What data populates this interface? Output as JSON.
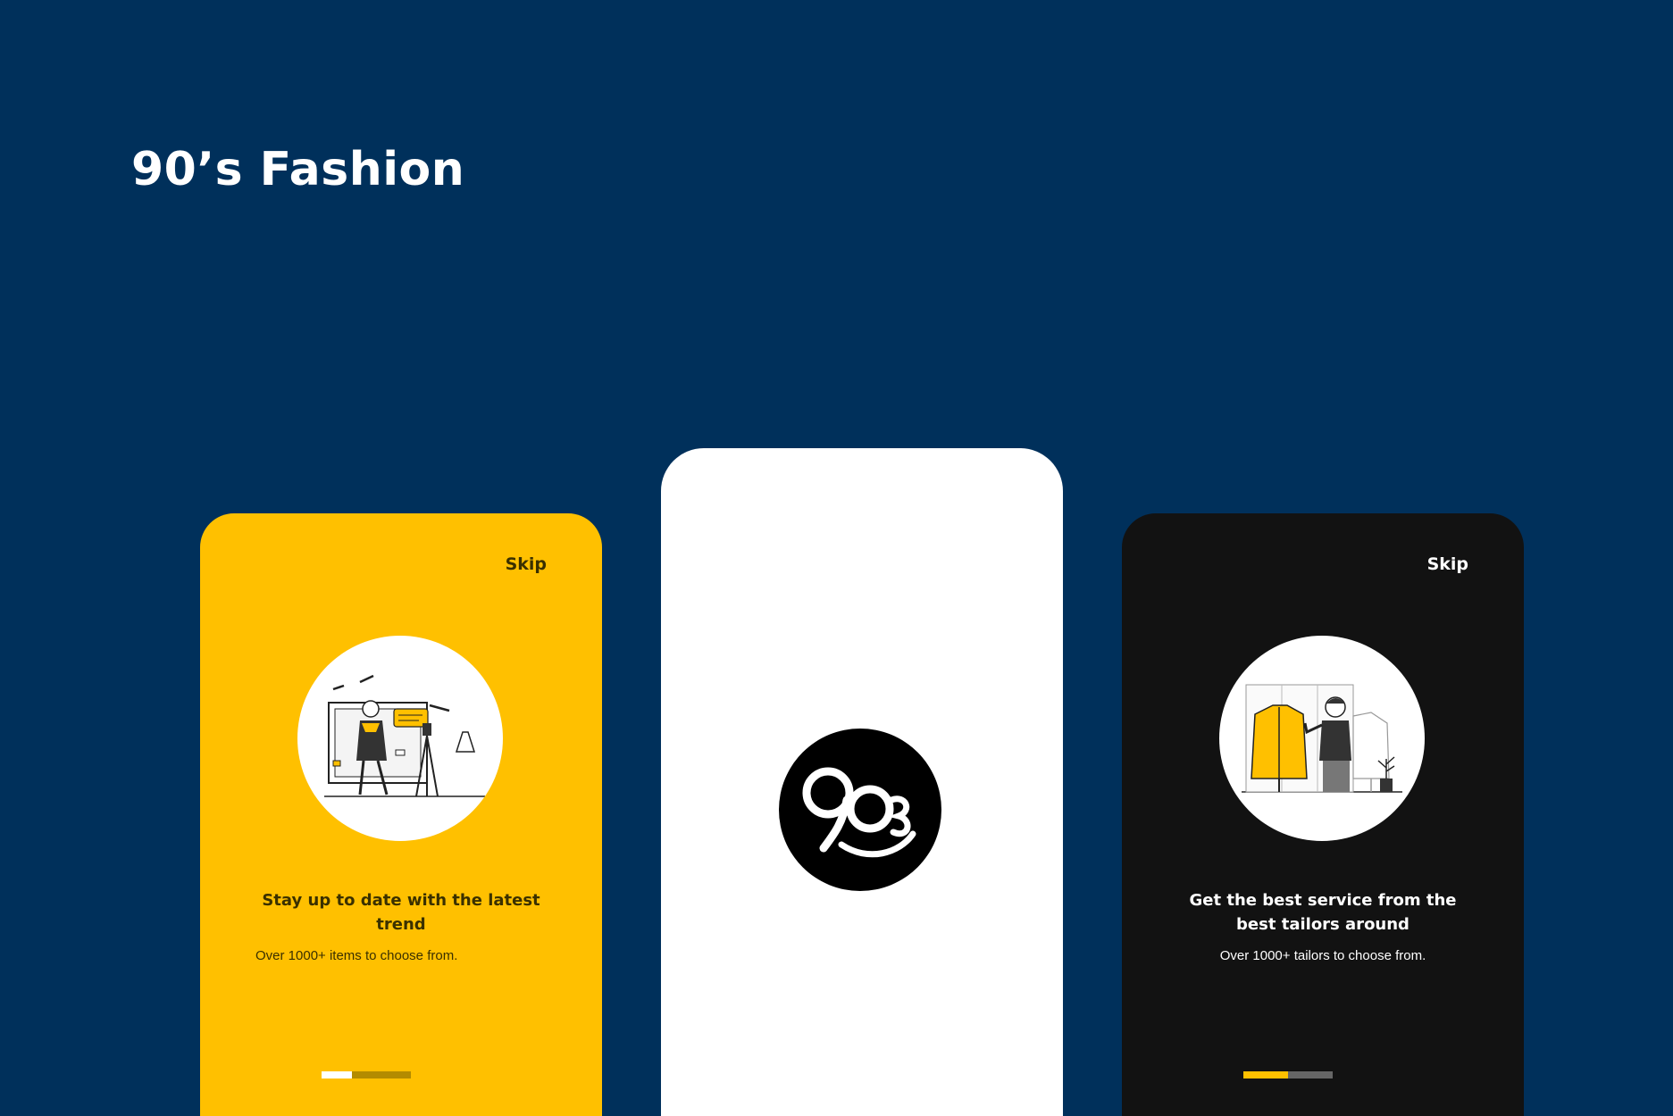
{
  "page": {
    "title": "90’s Fashion"
  },
  "screens": {
    "onboarding_trend": {
      "skip_label": "Skip",
      "heading": "Stay up to date with the latest trend",
      "subtext": "Over 1000+ items to choose from.",
      "illustration": "fashion-blogger-illustration",
      "background_color": "#ffc000",
      "progress": {
        "current": 1,
        "total": 2
      }
    },
    "splash": {
      "logo": "90s-logo-icon",
      "background_color": "#ffffff"
    },
    "onboarding_tailors": {
      "skip_label": "Skip",
      "heading": "Get the best service from the best tailors around",
      "subtext": "Over 1000+ tailors to choose from.",
      "illustration": "tailor-illustration",
      "background_color": "#121212",
      "progress": {
        "current": 2,
        "total": 2
      }
    }
  },
  "colors": {
    "background": "#00305b",
    "accent_yellow": "#ffc000",
    "dark": "#121212"
  }
}
